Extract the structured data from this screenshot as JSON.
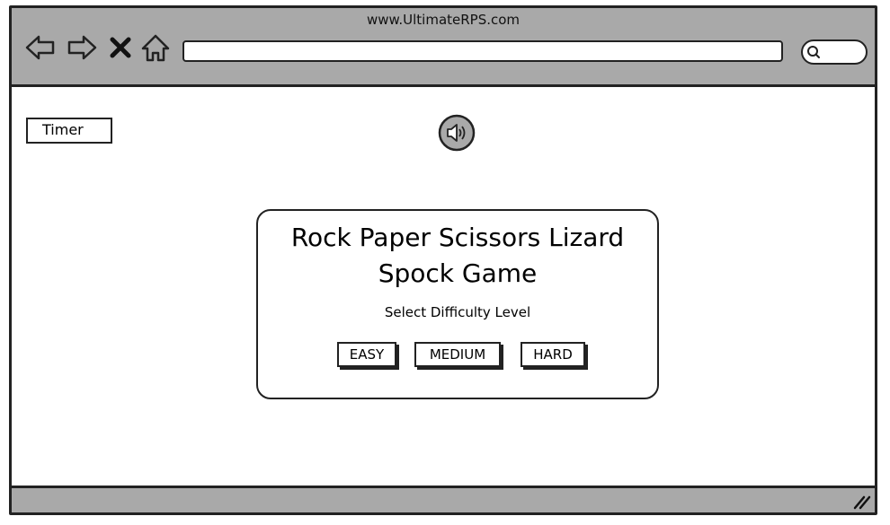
{
  "browser": {
    "url_title": "www.UltimateRPS.com",
    "icons": [
      "back-arrow-icon",
      "forward-arrow-icon",
      "close-x-icon",
      "home-icon",
      "search-icon"
    ]
  },
  "page": {
    "timer_label": "Timer",
    "sound_icon": "speaker-icon"
  },
  "modal": {
    "title_line1": "Rock Paper Scissors Lizard",
    "title_line2": "Spock Game",
    "subtitle": "Select Difficulty Level",
    "buttons": {
      "easy": "EASY",
      "medium": "MEDIUM",
      "hard": "HARD"
    }
  },
  "colors": {
    "chrome": "#a9a9a9",
    "stroke": "#222222",
    "background": "#ffffff"
  }
}
